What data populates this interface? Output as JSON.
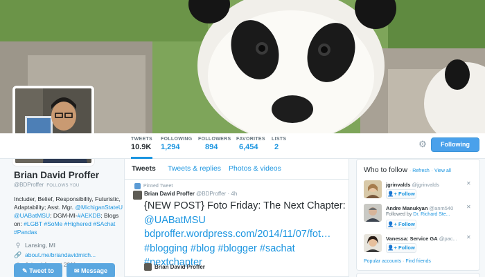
{
  "profile": {
    "name": "Brian David Proffer",
    "handle": "@BDProffer",
    "follows_you": "FOLLOWS YOU",
    "bio_parts": [
      {
        "text": "Includer, Belief, Responsibility, Futuristic, Adaptability; Asst. Mgr. ",
        "link": false
      },
      {
        "text": "@MichiganStateU",
        "link": true
      },
      {
        "text": " ",
        "link": false
      },
      {
        "text": "@UABatMSU",
        "link": true
      },
      {
        "text": "; DGM-MI-",
        "link": false
      },
      {
        "text": "#AEKDB",
        "link": true
      },
      {
        "text": "; Blogs on: ",
        "link": false
      },
      {
        "text": "#LGBT",
        "link": true
      },
      {
        "text": " ",
        "link": false
      },
      {
        "text": "#SoMe",
        "link": true
      },
      {
        "text": " ",
        "link": false
      },
      {
        "text": "#Highered",
        "link": true
      },
      {
        "text": " ",
        "link": false
      },
      {
        "text": "#SAchat",
        "link": true
      },
      {
        "text": " ",
        "link": false
      },
      {
        "text": "#Pandas",
        "link": true
      }
    ],
    "location": "Lansing, MI",
    "website": "about.me/briandavidmich...",
    "joined": "Joined August 2011",
    "tweet_to_label": "Tweet to",
    "message_label": "Message"
  },
  "stats": [
    {
      "label": "TWEETS",
      "value": "10.9K"
    },
    {
      "label": "FOLLOWING",
      "value": "1,294"
    },
    {
      "label": "FOLLOWERS",
      "value": "894"
    },
    {
      "label": "FAVORITES",
      "value": "6,454"
    },
    {
      "label": "LISTS",
      "value": "2"
    }
  ],
  "header": {
    "following_label": "Following"
  },
  "timeline": {
    "tabs": [
      "Tweets",
      "Tweets & replies",
      "Photos & videos"
    ],
    "pinned_label": "Pinned Tweet",
    "tweet": {
      "author": "Brian David Proffer",
      "handle": "@BDProffer",
      "time": "· 4h",
      "line1": "{NEW POST} Foto Friday: The Next Chapter:",
      "line2": "@UABatMSU",
      "line3": "bdproffer.wordpress.com/2014/11/07/fot…",
      "line4": "#blogging #blog #blogger #sachat",
      "line5": "#nextchapter",
      "card_author": "Brian David Proffer"
    }
  },
  "who_to_follow": {
    "title": "Who to follow",
    "refresh": "Refresh",
    "view_all": "View all",
    "follow_label": "Follow",
    "suggestions": [
      {
        "name": "jgrinvalds",
        "handle": "@jgrinvalds",
        "followed_by_prefix": "",
        "followed_by": ""
      },
      {
        "name": "Andre Manukyan",
        "handle": "@anm540",
        "followed_by_prefix": "Followed by ",
        "followed_by": "Dr. Richard Ste..."
      },
      {
        "name": "Vanessa: Service GA",
        "handle": "@pac...",
        "followed_by_prefix": "",
        "followed_by": ""
      }
    ],
    "popular_accounts": "Popular accounts",
    "find_friends": "Find friends"
  },
  "colors": {
    "accent": "#1b95e0",
    "follow_button": "#4aa1eb",
    "background": "#f5f8fa"
  },
  "icons": [
    "gear-icon",
    "location-pin-icon",
    "link-icon",
    "calendar-icon",
    "pin-icon",
    "close-icon",
    "follow-person-icon"
  ]
}
